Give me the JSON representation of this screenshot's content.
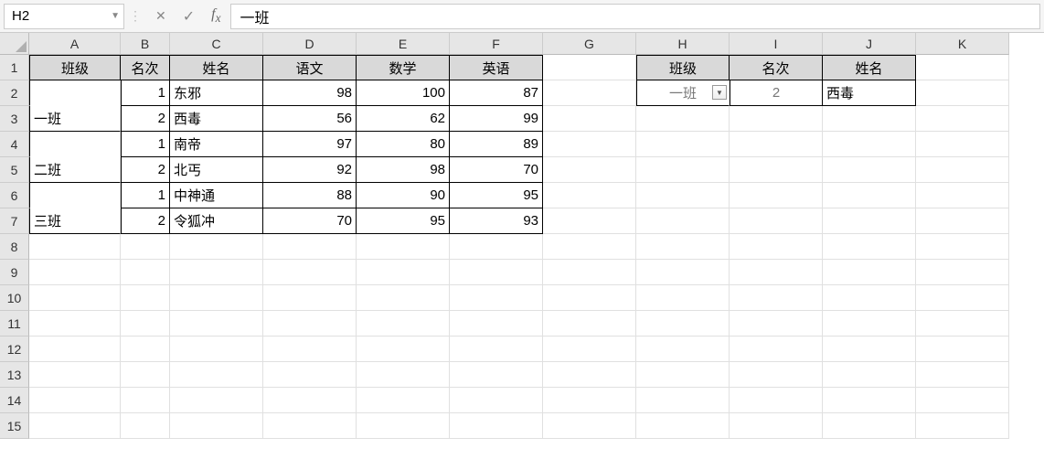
{
  "nameBox": "H2",
  "formulaValue": "一班",
  "colHeaders": [
    "A",
    "B",
    "C",
    "D",
    "E",
    "F",
    "G",
    "H",
    "I",
    "J",
    "K"
  ],
  "rowHeaders": [
    "1",
    "2",
    "3",
    "4",
    "5",
    "6",
    "7",
    "8",
    "9",
    "10",
    "11",
    "12",
    "13",
    "14",
    "15"
  ],
  "mainTable": {
    "headers": {
      "A": "班级",
      "B": "名次",
      "C": "姓名",
      "D": "语文",
      "E": "数学",
      "F": "英语"
    },
    "rows": [
      {
        "class": "一班",
        "rank": "1",
        "name": "东邪",
        "yw": "98",
        "sx": "100",
        "yy": "87"
      },
      {
        "class": "",
        "rank": "2",
        "name": "西毒",
        "yw": "56",
        "sx": "62",
        "yy": "99"
      },
      {
        "class": "二班",
        "rank": "1",
        "name": "南帝",
        "yw": "97",
        "sx": "80",
        "yy": "89"
      },
      {
        "class": "",
        "rank": "2",
        "name": "北丐",
        "yw": "92",
        "sx": "98",
        "yy": "70"
      },
      {
        "class": "三班",
        "rank": "1",
        "name": "中神通",
        "yw": "88",
        "sx": "90",
        "yy": "95"
      },
      {
        "class": "",
        "rank": "2",
        "name": "令狐冲",
        "yw": "70",
        "sx": "95",
        "yy": "93"
      }
    ],
    "mergedClass": {
      "r2": "一班",
      "r4": "二班",
      "r6": "三班"
    }
  },
  "lookupTable": {
    "headers": {
      "H": "班级",
      "I": "名次",
      "J": "姓名"
    },
    "row": {
      "H": "一班",
      "I": "2",
      "J": "西毒"
    }
  }
}
